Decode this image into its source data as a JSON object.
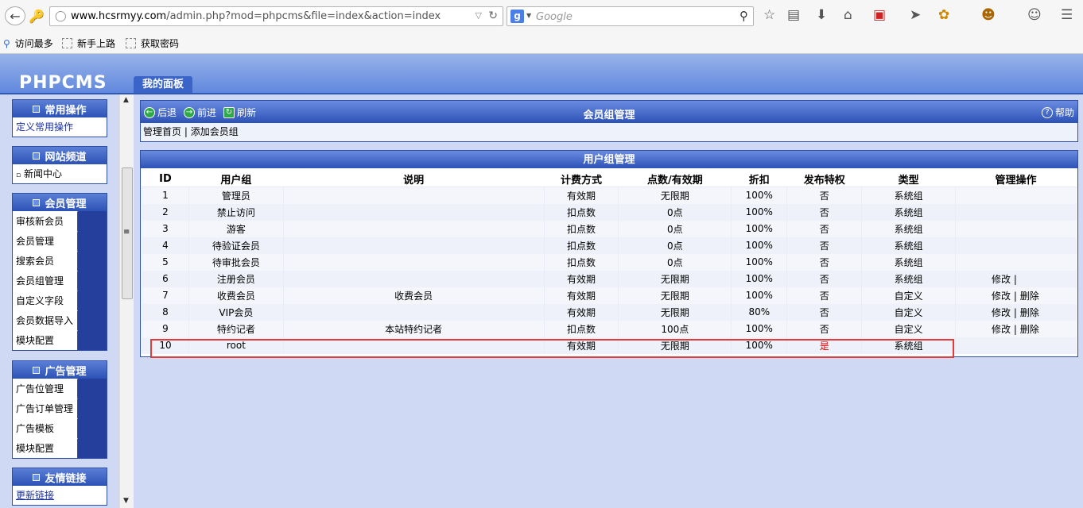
{
  "browser": {
    "url_host": "www.hcsrmyy.com",
    "url_path": "/admin.php?mod=phpcms&file=index&action=index",
    "search_placeholder": "Google",
    "bookmarks": [
      "访问最多",
      "新手上路",
      "获取密码"
    ]
  },
  "header": {
    "logo": "PHPCMS",
    "tab": "我的面板"
  },
  "sidebar": {
    "groups": [
      {
        "title": "常用操作",
        "items": [
          "定义常用操作"
        ]
      },
      {
        "title": "网站频道",
        "items": [
          "新闻中心"
        ]
      },
      {
        "title": "会员管理",
        "items": [
          "审核新会员",
          "会员管理",
          "搜索会员",
          "会员组管理",
          "自定义字段",
          "会员数据导入",
          "模块配置"
        ]
      },
      {
        "title": "广告管理",
        "items": [
          "广告位管理",
          "广告订单管理",
          "广告模板",
          "模块配置"
        ]
      },
      {
        "title": "友情链接",
        "items": [
          "更新链接"
        ]
      }
    ]
  },
  "main": {
    "back": "后退",
    "forward": "前进",
    "refresh": "刷新",
    "title": "会员组管理",
    "help": "帮助",
    "link_home": "管理首页",
    "link_sep": "|",
    "link_add": "添加会员组"
  },
  "table": {
    "caption": "用户组管理",
    "headers": [
      "ID",
      "用户组",
      "说明",
      "计费方式",
      "点数/有效期",
      "折扣",
      "发布特权",
      "类型",
      "管理操作"
    ],
    "rows": [
      {
        "id": "1",
        "group": "管理员",
        "desc": "",
        "billing": "有效期",
        "points": "无限期",
        "discount": "100%",
        "publish": "否",
        "type": "系统组",
        "actions": ""
      },
      {
        "id": "2",
        "group": "禁止访问",
        "desc": "",
        "billing": "扣点数",
        "points": "0点",
        "discount": "100%",
        "publish": "否",
        "type": "系统组",
        "actions": ""
      },
      {
        "id": "3",
        "group": "游客",
        "desc": "",
        "billing": "扣点数",
        "points": "0点",
        "discount": "100%",
        "publish": "否",
        "type": "系统组",
        "actions": ""
      },
      {
        "id": "4",
        "group": "待验证会员",
        "desc": "",
        "billing": "扣点数",
        "points": "0点",
        "discount": "100%",
        "publish": "否",
        "type": "系统组",
        "actions": ""
      },
      {
        "id": "5",
        "group": "待审批会员",
        "desc": "",
        "billing": "扣点数",
        "points": "0点",
        "discount": "100%",
        "publish": "否",
        "type": "系统组",
        "actions": ""
      },
      {
        "id": "6",
        "group": "注册会员",
        "desc": "",
        "billing": "有效期",
        "points": "无限期",
        "discount": "100%",
        "publish": "否",
        "type": "系统组",
        "actions": "修改 |"
      },
      {
        "id": "7",
        "group": "收费会员",
        "desc": "收费会员",
        "billing": "有效期",
        "points": "无限期",
        "discount": "100%",
        "publish": "否",
        "type": "自定义",
        "actions": "修改 | 删除"
      },
      {
        "id": "8",
        "group": "VIP会员",
        "desc": "",
        "billing": "有效期",
        "points": "无限期",
        "discount": "80%",
        "publish": "否",
        "type": "自定义",
        "actions": "修改 | 删除"
      },
      {
        "id": "9",
        "group": "特约记者",
        "desc": "本站特约记者",
        "billing": "扣点数",
        "points": "100点",
        "discount": "100%",
        "publish": "否",
        "type": "自定义",
        "actions": "修改 | 删除"
      },
      {
        "id": "10",
        "group": "root",
        "desc": "",
        "billing": "有效期",
        "points": "无限期",
        "discount": "100%",
        "publish": "是",
        "type": "系统组",
        "actions": ""
      }
    ]
  },
  "colors": {
    "accent": "#2c52b6",
    "highlight": "#e33a3a",
    "alert_text": "#dd0000"
  }
}
